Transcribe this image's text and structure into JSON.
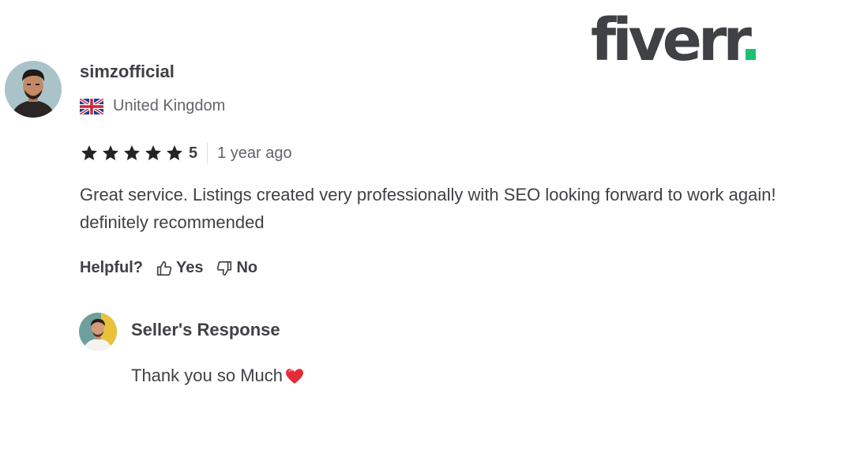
{
  "brand": {
    "logo_text": "fiverr",
    "logo_dot": ".",
    "accent": "#1dbf73"
  },
  "review": {
    "username": "simzofficial",
    "country": "United Kingdom",
    "flag_icon": "uk-flag-icon",
    "rating": "5",
    "stars": 5,
    "time_ago": "1 year ago",
    "text": "Great service. Listings created very professionally with SEO looking forward to work again! definitely recommended"
  },
  "helpful": {
    "label": "Helpful?",
    "yes_label": "Yes",
    "no_label": "No"
  },
  "seller_response": {
    "title": "Seller's Response",
    "text": "Thank you so Much",
    "emoji_icon": "heart-icon"
  }
}
